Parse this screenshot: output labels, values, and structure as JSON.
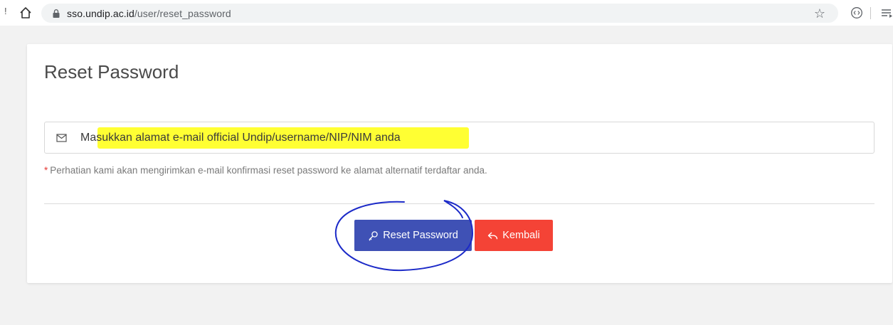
{
  "browser": {
    "left_mark": "!",
    "url_host": "sso.undip.ac.id",
    "url_path": "/user/reset_password",
    "icons": [
      "home-icon",
      "lock-icon",
      "star-icon",
      "extension-icon",
      "queue-icon"
    ]
  },
  "form": {
    "title": "Reset Password",
    "email_placeholder": "Masukkan alamat e-mail official Undip/username/NIP/NIM anda",
    "email_value": "",
    "note_asterisk": "*",
    "note_text": "Perhatian kami akan mengirimkan e-mail konfirmasi reset password ke alamat alternatif terdaftar anda.",
    "icons": [
      "envelope-icon"
    ]
  },
  "actions": {
    "reset_label": "Reset Password",
    "back_label": "Kembali",
    "icons": [
      "key-icon",
      "reply-icon"
    ]
  },
  "colors": {
    "primary": "#3f51b5",
    "danger": "#f44336",
    "highlight": "#ffff33",
    "annotation": "#1c2ac8",
    "background": "#f2f2f2"
  }
}
